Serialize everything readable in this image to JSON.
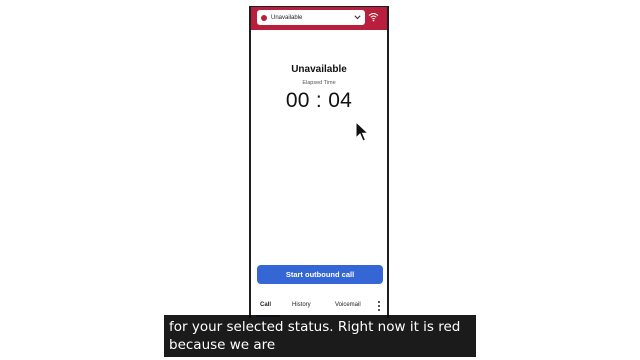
{
  "status_bar": {
    "selected_status": "Unavailable",
    "status_color": "#b81f3c",
    "dropdown_icon": "chevron-down-icon",
    "connection_icon": "wifi-icon"
  },
  "main": {
    "title": "Unavailable",
    "elapsed_label": "Elapsed Time",
    "timer": "00 : 04"
  },
  "actions": {
    "outbound_label": "Start outbound call",
    "outbound_color": "#3566d6"
  },
  "tabs": [
    {
      "label": "Call",
      "active": true
    },
    {
      "label": "History",
      "active": false
    },
    {
      "label": "Voicemail",
      "active": false
    }
  ],
  "more_icon": "more-vertical-icon",
  "caption": {
    "line1": "for your selected status. Right now it is red",
    "line2": "because we are"
  }
}
